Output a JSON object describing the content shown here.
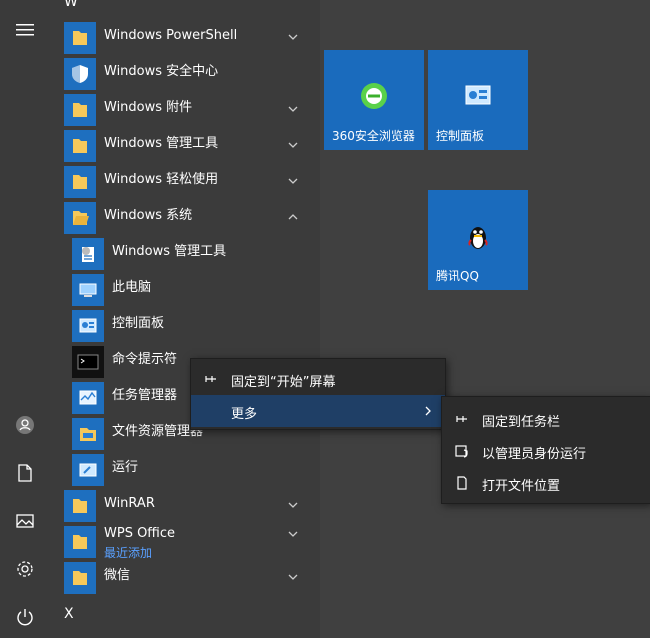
{
  "list": {
    "letter_w": "W",
    "letter_x": "X",
    "items": [
      {
        "label": "Windows PowerShell",
        "icon": "folder-icon",
        "expandable": true,
        "expanded": false
      },
      {
        "label": "Windows 安全中心",
        "icon": "shield-icon",
        "expandable": false
      },
      {
        "label": "Windows 附件",
        "icon": "folder-icon",
        "expandable": true,
        "expanded": false
      },
      {
        "label": "Windows 管理工具",
        "icon": "folder-icon",
        "expandable": true,
        "expanded": false
      },
      {
        "label": "Windows 轻松使用",
        "icon": "folder-icon",
        "expandable": true,
        "expanded": false
      },
      {
        "label": "Windows 系统",
        "icon": "folder-icon",
        "expandable": true,
        "expanded": true
      }
    ],
    "subitems": [
      {
        "label": "Windows 管理工具",
        "icon": "admin-tools-icon"
      },
      {
        "label": "此电脑",
        "icon": "computer-icon"
      },
      {
        "label": "控制面板",
        "icon": "control-panel-icon"
      },
      {
        "label": "命令提示符",
        "icon": "cmd-icon"
      },
      {
        "label": "任务管理器",
        "icon": "task-manager-icon"
      },
      {
        "label": "文件资源管理器",
        "icon": "file-explorer-icon"
      },
      {
        "label": "运行",
        "icon": "run-icon"
      }
    ],
    "more_items": [
      {
        "label": "WinRAR",
        "icon": "folder-icon",
        "expandable": true
      },
      {
        "label": "WPS Office",
        "sublabel": "最近添加",
        "icon": "folder-icon",
        "expandable": true
      },
      {
        "label": "微信",
        "icon": "folder-icon",
        "expandable": true
      }
    ]
  },
  "tiles": [
    {
      "label": "360安全浏览器",
      "icon": "360-browser-icon"
    },
    {
      "label": "控制面板",
      "icon": "control-panel-icon"
    },
    {
      "label": "腾讯QQ",
      "icon": "qq-penguin-icon"
    }
  ],
  "context_menu": {
    "pin_start": "固定到“开始”屏幕",
    "more": "更多"
  },
  "submenu": {
    "pin_taskbar": "固定到任务栏",
    "run_as_admin": "以管理员身份运行",
    "open_location": "打开文件位置"
  },
  "colors": {
    "tile_blue": "#1a6bbd",
    "background": "#404040",
    "accent_link": "#5aa0ff"
  }
}
